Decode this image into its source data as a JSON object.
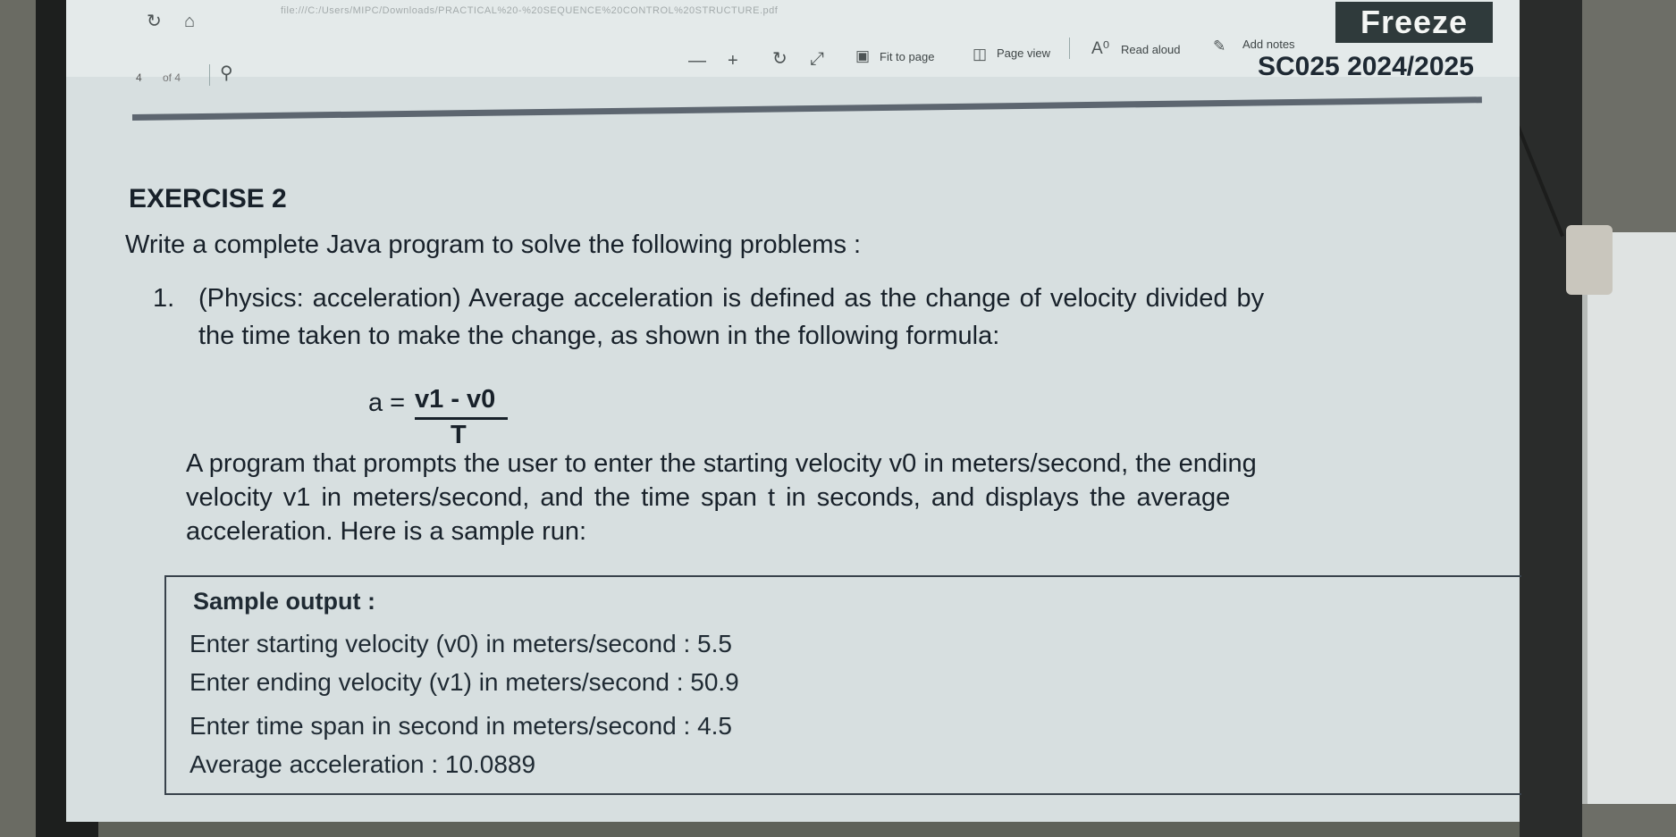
{
  "viewer": {
    "address_bar": "file:///C:/Users/MIPC/Downloads/PRACTICAL%20-%20SEQUENCE%20CONTROL%20STRUCTURE.pdf",
    "page_number": "4",
    "page_total": "of 4",
    "toolbar": {
      "fit_to_page": "Fit to page",
      "page_view": "Page view",
      "read_aloud": "Read aloud",
      "add_notes": "Add notes"
    }
  },
  "freeze_label": "Freeze",
  "document": {
    "course": "SC025 2024/2025",
    "heading": "EXERCISE 2",
    "intro": "Write a complete Java program to solve the following problems :",
    "question_number": "1.",
    "question_line1": "(Physics: acceleration) Average acceleration is defined as the change of velocity divided by",
    "question_line2": "the time taken to make the change, as shown in the following formula:",
    "formula": {
      "lhs": "a =",
      "numerator": "v1 - v0",
      "denominator": "T"
    },
    "paragraph_lines": [
      "A program that prompts the user to enter the starting velocity v0 in meters/second, the ending",
      "velocity v1 in meters/second, and the time span t in seconds, and displays the average",
      "acceleration. Here is a sample run:"
    ],
    "sample": {
      "title": "Sample output :",
      "lines": [
        "Enter starting velocity (v0) in meters/second : 5.5",
        "Enter ending velocity (v1) in meters/second : 50.9",
        "Enter time span in second in meters/second : 4.5",
        "Average acceleration : 10.0889"
      ]
    }
  }
}
